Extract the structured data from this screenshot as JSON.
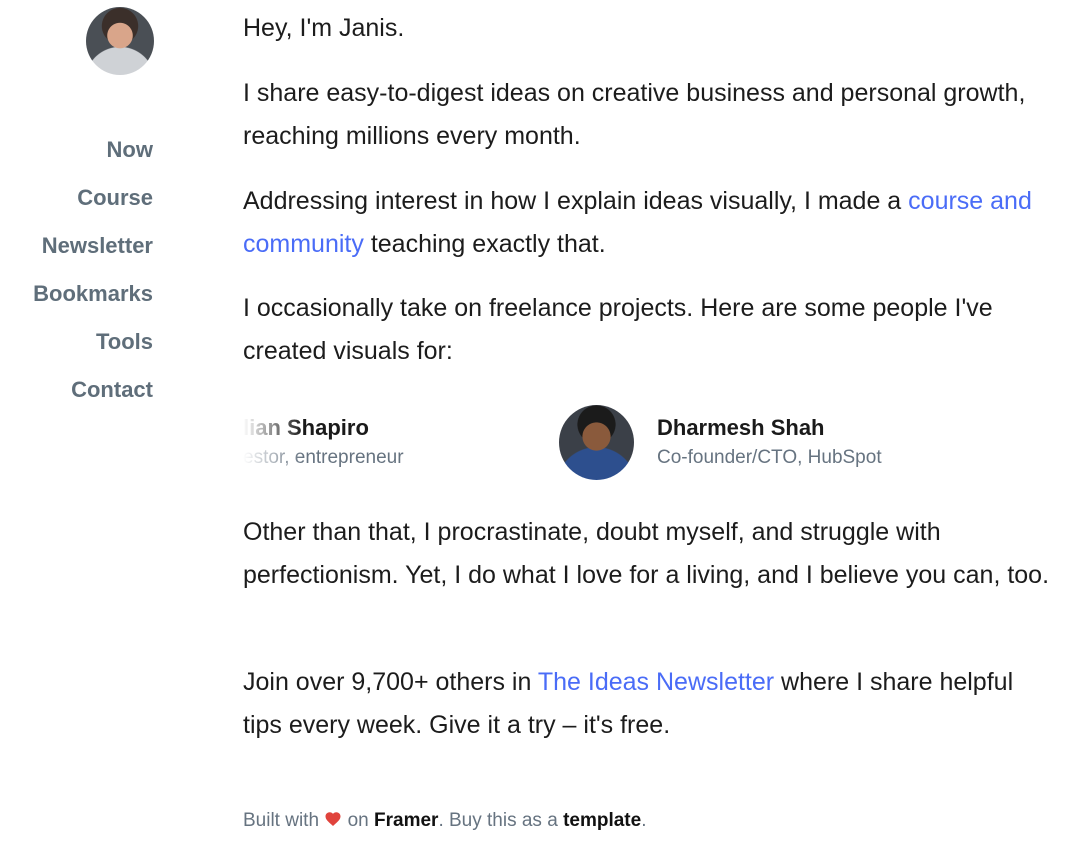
{
  "sidebar": {
    "avatar_name": "avatar",
    "nav": [
      {
        "label": "Now"
      },
      {
        "label": "Course"
      },
      {
        "label": "Newsletter"
      },
      {
        "label": "Bookmarks"
      },
      {
        "label": "Tools"
      },
      {
        "label": "Contact"
      }
    ]
  },
  "main": {
    "intro": "Hey, I'm Janis.",
    "share": "I share easy-to-digest ideas on creative business and personal growth, reaching millions every month.",
    "address_before": "Addressing interest in how I explain ideas visually, I made a ",
    "address_link": "course and community",
    "address_after": " teaching exactly that.",
    "freelance": "I occasionally take on freelance projects. Here are some people I've created visuals for:",
    "people": [
      {
        "name": "lian Shapiro",
        "role": "estor, entrepreneur"
      },
      {
        "name": "Dharmesh Shah",
        "role": "Co-founder/CTO, HubSpot"
      }
    ],
    "other": "Other than that, I procrastinate, doubt myself, and struggle with perfectionism. Yet, I do what I love for a living, and I believe you can, too.",
    "join_before": "Join over 9,700+ others in ",
    "join_link": "The Ideas Newsletter",
    "join_after": " where I share helpful tips every week. Give it a try – it's free."
  },
  "footer": {
    "built_with": "Built with",
    "on": "on",
    "framer": "Framer",
    "buy": ". Buy this as a",
    "template": "template",
    "end": ".",
    "heart_icon": "heart-icon",
    "heart_color": "#e0433c"
  },
  "colors": {
    "link": "#4a6cf7",
    "nav": "#5f6e7a",
    "muted": "#667380"
  }
}
